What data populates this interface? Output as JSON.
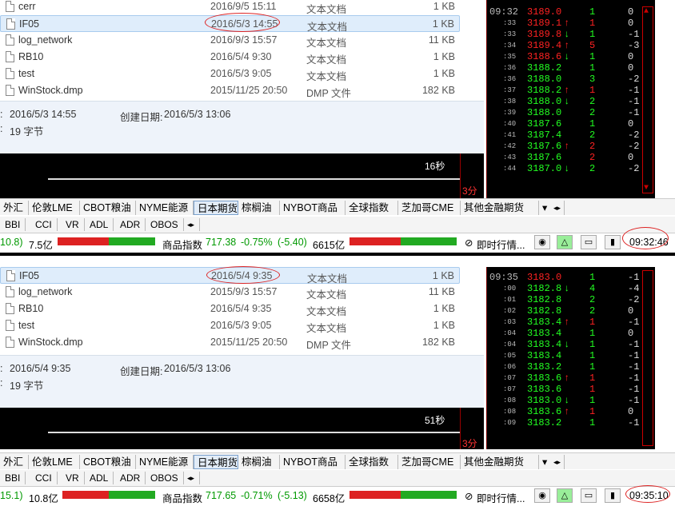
{
  "top": {
    "files": [
      {
        "name": "cerr",
        "date": "2016/9/5 15:11",
        "type": "文本文档",
        "size": "1 KB"
      },
      {
        "name": "IF05",
        "date": "2016/5/3 14:55",
        "type": "文本文档",
        "size": "1 KB",
        "selected": true
      },
      {
        "name": "log_network",
        "date": "2016/9/3 15:57",
        "type": "文本文档",
        "size": "11 KB"
      },
      {
        "name": "RB10",
        "date": "2016/5/4 9:30",
        "type": "文本文档",
        "size": "1 KB"
      },
      {
        "name": "test",
        "date": "2016/5/3 9:05",
        "type": "文本文档",
        "size": "1 KB"
      },
      {
        "name": "WinStock.dmp",
        "date": "2015/11/25 20:50",
        "type": "DMP 文件",
        "size": "182 KB"
      }
    ],
    "details": {
      "modified": "2016/5/3 14:55",
      "created_label": "创建日期:",
      "created": "2016/5/3 13:06",
      "size": "19 字节"
    },
    "seconds": "16秒",
    "minutes": "3分",
    "tick_header_time": "09:32",
    "ticks": [
      {
        "t": "09:32",
        "p": "3189.0",
        "a": "",
        "v": "1",
        "c": "0",
        "pg": false,
        "vr": false,
        "big": true
      },
      {
        "t": ":33",
        "p": "3189.1",
        "a": "↑",
        "v": "1",
        "c": "0",
        "pg": false,
        "vr": true
      },
      {
        "t": ":33",
        "p": "3189.8",
        "a": "↓",
        "v": "1",
        "c": "-1",
        "pg": false,
        "vr": false
      },
      {
        "t": ":34",
        "p": "3189.4",
        "a": "↑",
        "v": "5",
        "c": "-3",
        "pg": false,
        "vr": true
      },
      {
        "t": ":35",
        "p": "3188.6",
        "a": "↓",
        "v": "1",
        "c": "0",
        "pg": false,
        "vr": false
      },
      {
        "t": ":36",
        "p": "3188.2",
        "a": "",
        "v": "1",
        "c": "0",
        "pg": true,
        "vr": false
      },
      {
        "t": ":36",
        "p": "3188.0",
        "a": "",
        "v": "3",
        "c": "-2",
        "pg": true,
        "vr": false
      },
      {
        "t": ":37",
        "p": "3188.2",
        "a": "↑",
        "v": "1",
        "c": "-1",
        "pg": true,
        "vr": true
      },
      {
        "t": ":38",
        "p": "3188.0",
        "a": "↓",
        "v": "2",
        "c": "-1",
        "pg": true,
        "vr": false
      },
      {
        "t": ":39",
        "p": "3188.0",
        "a": "",
        "v": "2",
        "c": "-1",
        "pg": true,
        "vr": false
      },
      {
        "t": ":40",
        "p": "3187.6",
        "a": "",
        "v": "1",
        "c": "0",
        "pg": true,
        "vr": false
      },
      {
        "t": ":41",
        "p": "3187.4",
        "a": "",
        "v": "2",
        "c": "-2",
        "pg": true,
        "vr": false
      },
      {
        "t": ":42",
        "p": "3187.6",
        "a": "↑",
        "v": "2",
        "c": "-2",
        "pg": true,
        "vr": true
      },
      {
        "t": ":43",
        "p": "3187.6",
        "a": "",
        "v": "2",
        "c": "0",
        "pg": true,
        "vr": true
      },
      {
        "t": ":44",
        "p": "3187.0",
        "a": "↓",
        "v": "2",
        "c": "-2",
        "pg": true,
        "vr": false
      }
    ],
    "status": {
      "left_val": "10.8)",
      "amt1": "7.5亿",
      "label": "商品指数",
      "index": "717.38",
      "pct": "-0.75%",
      "chg": "(-5.40)",
      "amt2": "6615亿",
      "realtime": "即时行情...",
      "clock": "09:32:46"
    }
  },
  "bottom": {
    "files": [
      {
        "name": "IF05",
        "date": "2016/5/4 9:35",
        "type": "文本文档",
        "size": "1 KB",
        "selected": true
      },
      {
        "name": "log_network",
        "date": "2015/9/3 15:57",
        "type": "文本文档",
        "size": "11 KB"
      },
      {
        "name": "RB10",
        "date": "2016/5/4 9:35",
        "type": "文本文档",
        "size": "1 KB"
      },
      {
        "name": "test",
        "date": "2016/5/3 9:05",
        "type": "文本文档",
        "size": "1 KB"
      },
      {
        "name": "WinStock.dmp",
        "date": "2015/11/25 20:50",
        "type": "DMP 文件",
        "size": "182 KB"
      }
    ],
    "details": {
      "modified": "2016/5/4 9:35",
      "created_label": "创建日期:",
      "created": "2016/5/3 13:06",
      "size": "19 字节"
    },
    "seconds": "51秒",
    "minutes": "3分",
    "ticks": [
      {
        "t": "09:35",
        "p": "3183.0",
        "a": "",
        "v": "1",
        "c": "-1",
        "pg": false,
        "vr": false,
        "big": true
      },
      {
        "t": ":00",
        "p": "3182.8",
        "a": "↓",
        "v": "4",
        "c": "-4",
        "pg": true,
        "vr": false
      },
      {
        "t": ":01",
        "p": "3182.8",
        "a": "",
        "v": "2",
        "c": "-2",
        "pg": true,
        "vr": false
      },
      {
        "t": ":02",
        "p": "3182.8",
        "a": "",
        "v": "2",
        "c": "0",
        "pg": true,
        "vr": false
      },
      {
        "t": ":03",
        "p": "3183.4",
        "a": "↑",
        "v": "1",
        "c": "-1",
        "pg": true,
        "vr": true
      },
      {
        "t": ":04",
        "p": "3183.4",
        "a": "",
        "v": "1",
        "c": "0",
        "pg": true,
        "vr": false
      },
      {
        "t": ":04",
        "p": "3183.4",
        "a": "↓",
        "v": "1",
        "c": "-1",
        "pg": true,
        "vr": false
      },
      {
        "t": ":05",
        "p": "3183.4",
        "a": "",
        "v": "1",
        "c": "-1",
        "pg": true,
        "vr": false
      },
      {
        "t": ":06",
        "p": "3183.2",
        "a": "",
        "v": "1",
        "c": "-1",
        "pg": true,
        "vr": false
      },
      {
        "t": ":07",
        "p": "3183.6",
        "a": "↑",
        "v": "1",
        "c": "-1",
        "pg": true,
        "vr": true
      },
      {
        "t": ":07",
        "p": "3183.6",
        "a": "",
        "v": "1",
        "c": "-1",
        "pg": true,
        "vr": true
      },
      {
        "t": ":08",
        "p": "3183.0",
        "a": "↓",
        "v": "1",
        "c": "-1",
        "pg": true,
        "vr": false
      },
      {
        "t": ":08",
        "p": "3183.6",
        "a": "↑",
        "v": "1",
        "c": "0",
        "pg": true,
        "vr": true
      },
      {
        "t": ":09",
        "p": "3183.2",
        "a": "",
        "v": "1",
        "c": "-1",
        "pg": true,
        "vr": false
      }
    ],
    "status": {
      "left_val": "15.1)",
      "amt1": "10.8亿",
      "label": "商品指数",
      "index": "717.65",
      "pct": "-0.71%",
      "chg": "(-5.13)",
      "amt2": "6658亿",
      "realtime": "即时行情...",
      "clock": "09:35:10"
    }
  },
  "tabs": [
    "外汇",
    "伦敦LME",
    "CBOT粮油",
    "NYME能源",
    "日本期货",
    "棕榈油",
    "NYBOT商品",
    "全球指数",
    "芝加哥CME",
    "其他金融期货"
  ],
  "active_tab": "日本期货",
  "indicators": [
    "BBI",
    "CCI",
    "VR",
    "ADL",
    "ADR",
    "OBOS"
  ],
  "colors": {
    "up": "#ff2222",
    "down": "#22ff22",
    "accent": "#d22222"
  }
}
